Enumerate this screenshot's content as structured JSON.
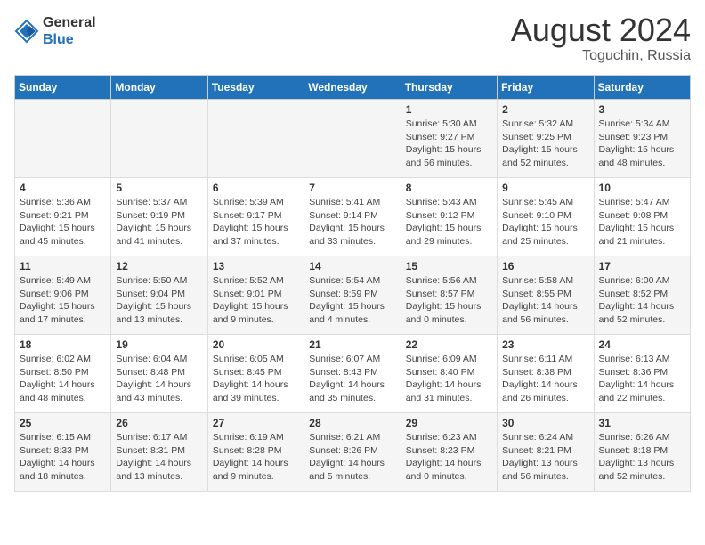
{
  "header": {
    "logo_line1": "General",
    "logo_line2": "Blue",
    "month_year": "August 2024",
    "location": "Toguchin, Russia"
  },
  "days_of_week": [
    "Sunday",
    "Monday",
    "Tuesday",
    "Wednesday",
    "Thursday",
    "Friday",
    "Saturday"
  ],
  "weeks": [
    [
      {
        "day": "",
        "info": ""
      },
      {
        "day": "",
        "info": ""
      },
      {
        "day": "",
        "info": ""
      },
      {
        "day": "",
        "info": ""
      },
      {
        "day": "1",
        "info": "Sunrise: 5:30 AM\nSunset: 9:27 PM\nDaylight: 15 hours\nand 56 minutes."
      },
      {
        "day": "2",
        "info": "Sunrise: 5:32 AM\nSunset: 9:25 PM\nDaylight: 15 hours\nand 52 minutes."
      },
      {
        "day": "3",
        "info": "Sunrise: 5:34 AM\nSunset: 9:23 PM\nDaylight: 15 hours\nand 48 minutes."
      }
    ],
    [
      {
        "day": "4",
        "info": "Sunrise: 5:36 AM\nSunset: 9:21 PM\nDaylight: 15 hours\nand 45 minutes."
      },
      {
        "day": "5",
        "info": "Sunrise: 5:37 AM\nSunset: 9:19 PM\nDaylight: 15 hours\nand 41 minutes."
      },
      {
        "day": "6",
        "info": "Sunrise: 5:39 AM\nSunset: 9:17 PM\nDaylight: 15 hours\nand 37 minutes."
      },
      {
        "day": "7",
        "info": "Sunrise: 5:41 AM\nSunset: 9:14 PM\nDaylight: 15 hours\nand 33 minutes."
      },
      {
        "day": "8",
        "info": "Sunrise: 5:43 AM\nSunset: 9:12 PM\nDaylight: 15 hours\nand 29 minutes."
      },
      {
        "day": "9",
        "info": "Sunrise: 5:45 AM\nSunset: 9:10 PM\nDaylight: 15 hours\nand 25 minutes."
      },
      {
        "day": "10",
        "info": "Sunrise: 5:47 AM\nSunset: 9:08 PM\nDaylight: 15 hours\nand 21 minutes."
      }
    ],
    [
      {
        "day": "11",
        "info": "Sunrise: 5:49 AM\nSunset: 9:06 PM\nDaylight: 15 hours\nand 17 minutes."
      },
      {
        "day": "12",
        "info": "Sunrise: 5:50 AM\nSunset: 9:04 PM\nDaylight: 15 hours\nand 13 minutes."
      },
      {
        "day": "13",
        "info": "Sunrise: 5:52 AM\nSunset: 9:01 PM\nDaylight: 15 hours\nand 9 minutes."
      },
      {
        "day": "14",
        "info": "Sunrise: 5:54 AM\nSunset: 8:59 PM\nDaylight: 15 hours\nand 4 minutes."
      },
      {
        "day": "15",
        "info": "Sunrise: 5:56 AM\nSunset: 8:57 PM\nDaylight: 15 hours\nand 0 minutes."
      },
      {
        "day": "16",
        "info": "Sunrise: 5:58 AM\nSunset: 8:55 PM\nDaylight: 14 hours\nand 56 minutes."
      },
      {
        "day": "17",
        "info": "Sunrise: 6:00 AM\nSunset: 8:52 PM\nDaylight: 14 hours\nand 52 minutes."
      }
    ],
    [
      {
        "day": "18",
        "info": "Sunrise: 6:02 AM\nSunset: 8:50 PM\nDaylight: 14 hours\nand 48 minutes."
      },
      {
        "day": "19",
        "info": "Sunrise: 6:04 AM\nSunset: 8:48 PM\nDaylight: 14 hours\nand 43 minutes."
      },
      {
        "day": "20",
        "info": "Sunrise: 6:05 AM\nSunset: 8:45 PM\nDaylight: 14 hours\nand 39 minutes."
      },
      {
        "day": "21",
        "info": "Sunrise: 6:07 AM\nSunset: 8:43 PM\nDaylight: 14 hours\nand 35 minutes."
      },
      {
        "day": "22",
        "info": "Sunrise: 6:09 AM\nSunset: 8:40 PM\nDaylight: 14 hours\nand 31 minutes."
      },
      {
        "day": "23",
        "info": "Sunrise: 6:11 AM\nSunset: 8:38 PM\nDaylight: 14 hours\nand 26 minutes."
      },
      {
        "day": "24",
        "info": "Sunrise: 6:13 AM\nSunset: 8:36 PM\nDaylight: 14 hours\nand 22 minutes."
      }
    ],
    [
      {
        "day": "25",
        "info": "Sunrise: 6:15 AM\nSunset: 8:33 PM\nDaylight: 14 hours\nand 18 minutes."
      },
      {
        "day": "26",
        "info": "Sunrise: 6:17 AM\nSunset: 8:31 PM\nDaylight: 14 hours\nand 13 minutes."
      },
      {
        "day": "27",
        "info": "Sunrise: 6:19 AM\nSunset: 8:28 PM\nDaylight: 14 hours\nand 9 minutes."
      },
      {
        "day": "28",
        "info": "Sunrise: 6:21 AM\nSunset: 8:26 PM\nDaylight: 14 hours\nand 5 minutes."
      },
      {
        "day": "29",
        "info": "Sunrise: 6:23 AM\nSunset: 8:23 PM\nDaylight: 14 hours\nand 0 minutes."
      },
      {
        "day": "30",
        "info": "Sunrise: 6:24 AM\nSunset: 8:21 PM\nDaylight: 13 hours\nand 56 minutes."
      },
      {
        "day": "31",
        "info": "Sunrise: 6:26 AM\nSunset: 8:18 PM\nDaylight: 13 hours\nand 52 minutes."
      }
    ]
  ]
}
